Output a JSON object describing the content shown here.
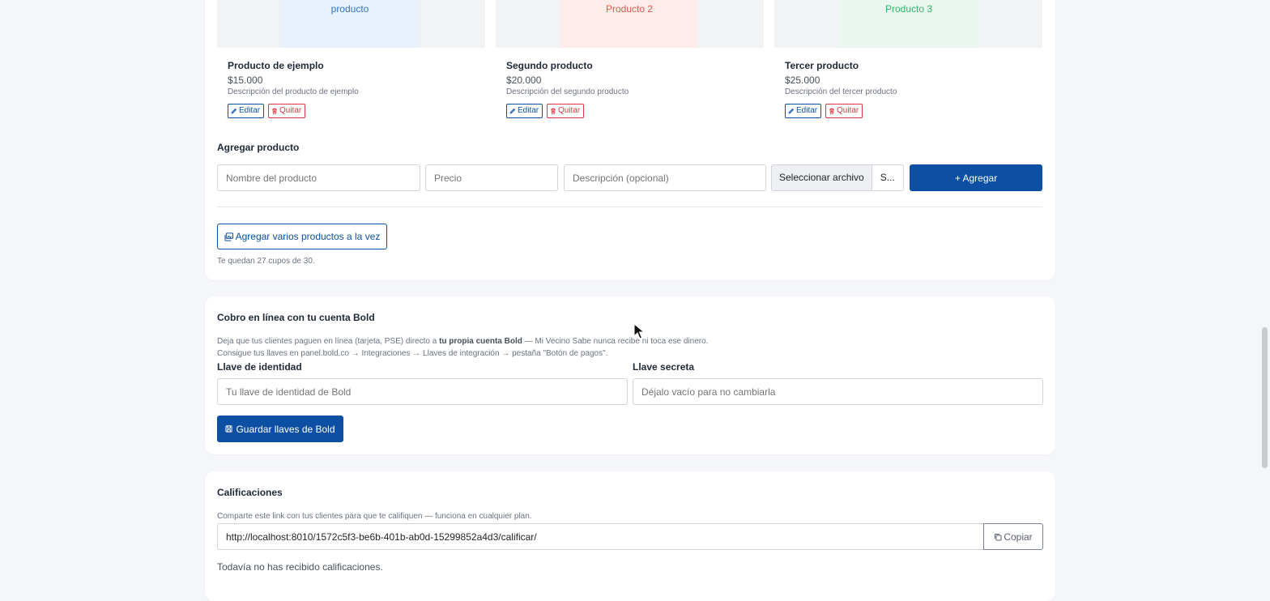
{
  "products": [
    {
      "placeholder": "producto",
      "placeholder_color": "#2f73c8",
      "tile_bg": "#e9f2fc",
      "name": "Producto de ejemplo",
      "price": "$15.000",
      "description": "Descripción del producto de ejemplo"
    },
    {
      "placeholder": "Producto 2",
      "placeholder_color": "#e05a4b",
      "tile_bg": "#fdecea",
      "name": "Segundo producto",
      "price": "$20.000",
      "description": "Descripción del segundo producto"
    },
    {
      "placeholder": "Producto 3",
      "placeholder_color": "#2fb56a",
      "tile_bg": "#eaf7ee",
      "name": "Tercer producto",
      "price": "$25.000",
      "description": "Descripción del tercer producto"
    }
  ],
  "product_actions": {
    "edit_label": "Editar",
    "remove_label": "Quitar"
  },
  "add_product": {
    "title": "Agregar producto",
    "name_placeholder": "Nombre del producto",
    "price_placeholder": "Precio",
    "description_placeholder": "Descripción (opcional)",
    "file_button_label": "Seleccionar archivo",
    "file_status": "S...",
    "submit_label": "+ Agregar"
  },
  "bulk": {
    "button_label": "Agregar varios productos a la vez",
    "quota_text": "Te quedan 27 cupos de 30."
  },
  "bold": {
    "title": "Cobro en línea con tu cuenta Bold",
    "desc_before": "Deja que tus clientes paguen en línea (tarjeta, PSE) directo a ",
    "desc_strong": "tu propia cuenta Bold",
    "desc_after": " — Mi Vecino Sabe nunca recibe ni toca ese dinero.",
    "desc_line2": "Consigue tus llaves en panel.bold.co → Integraciones → Llaves de integración → pestaña \"Botón de pagos\".",
    "identity_label": "Llave de identidad",
    "identity_placeholder": "Tu llave de identidad de Bold",
    "secret_label": "Llave secreta",
    "secret_placeholder": "Déjalo vacío para no cambiarla",
    "save_label": "Guardar llaves de Bold"
  },
  "ratings": {
    "title": "Calificaciones",
    "description": "Comparte este link con tus clientes para que te califiquen — funciona en cualquier plan.",
    "link": "http://localhost:8010/1572c5f3-be6b-401b-ab0d-15299852a4d3/calificar/",
    "copy_label": "Copiar",
    "empty_text": "Todavía no has recibido calificaciones."
  },
  "colors": {
    "accent": "#0d4fa3",
    "danger": "#dc3545"
  }
}
